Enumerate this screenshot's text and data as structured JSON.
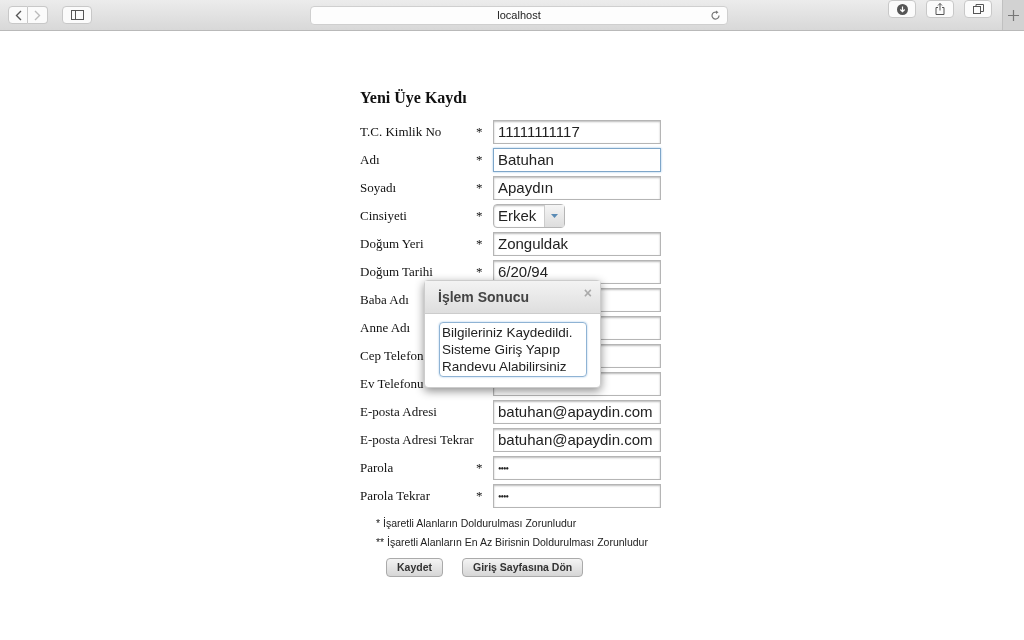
{
  "browser": {
    "address": "localhost"
  },
  "form": {
    "title": "Yeni Üye Kaydı",
    "rows": [
      {
        "label": "T.C. Kimlik No",
        "marker": "*",
        "kind": "text",
        "value": "11111111117",
        "focused": false
      },
      {
        "label": "Adı",
        "marker": "*",
        "kind": "text",
        "value": "Batuhan",
        "focused": true
      },
      {
        "label": "Soyadı",
        "marker": "*",
        "kind": "text",
        "value": "Apaydın",
        "focused": false
      },
      {
        "label": "Cinsiyeti",
        "marker": "*",
        "kind": "select",
        "value": "Erkek",
        "focused": false
      },
      {
        "label": "Doğum Yeri",
        "marker": "*",
        "kind": "text",
        "value": "Zonguldak",
        "focused": false
      },
      {
        "label": "Doğum Tarihi",
        "marker": "*",
        "kind": "text",
        "value": "6/20/94",
        "focused": false
      },
      {
        "label": "Baba Adı",
        "kind": "text",
        "focused": false
      },
      {
        "label": "Anne Adı",
        "kind": "text",
        "focused": false
      },
      {
        "label": "Cep Telefon",
        "kind": "text",
        "focused": false
      },
      {
        "label": "Ev Telefonu",
        "kind": "text",
        "focused": false
      },
      {
        "label": "E-posta Adresi",
        "kind": "text",
        "value": "batuhan@apaydin.com",
        "focused": false
      },
      {
        "label": "E-posta Adresi Tekrar",
        "kind": "text",
        "value": "batuhan@apaydin.com",
        "focused": false
      },
      {
        "label": "Parola",
        "marker": "*",
        "kind": "password",
        "value": "••••",
        "focused": false
      },
      {
        "label": "Parola Tekrar",
        "marker": "*",
        "kind": "password",
        "value": "••••",
        "focused": false
      }
    ],
    "notes": [
      "* İşaretli Alanların Doldurulması Zorunludur",
      "** İşaretli Alanların En Az Birisnin Doldurulması Zorunludur"
    ],
    "buttons": [
      "Kaydet",
      "Giriş Sayfasına Dön"
    ]
  },
  "dialog": {
    "title": "İşlem Sonucu",
    "close": "×",
    "message_lines": [
      "Bilgileriniz Kaydedildi.",
      "Sisteme Giriş Yapıp",
      "Randevu Alabilirsiniz"
    ]
  }
}
